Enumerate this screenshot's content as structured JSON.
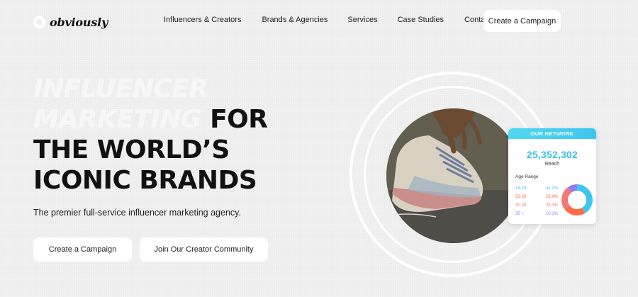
{
  "brand": {
    "name": "obviously"
  },
  "nav": {
    "links": [
      "Influencers & Creators",
      "Brands & Agencies",
      "Services",
      "Case Studies",
      "Contact"
    ],
    "cta": "Create a Campaign"
  },
  "hero": {
    "ghost_line1": "INFLUENCER",
    "ghost_line2": "MARKETING",
    "line2_rest": "FOR",
    "line3": "THE WORLD’S",
    "line4": "ICONIC BRANDS",
    "subtitle": "The premier full-service influencer marketing agency.",
    "btn_campaign": "Create a Campaign",
    "btn_community": "Join Our Creator Community"
  },
  "network_card": {
    "header": "OUR NETWORK",
    "total": "25,352,302",
    "total_label": "Reach",
    "age_label": "Age Range",
    "rows": [
      {
        "range": "18-24",
        "pct": "41.2%",
        "color": "#3ec5f0"
      },
      {
        "range": "25-29",
        "pct": "23.4%",
        "color": "#ff6a4a"
      },
      {
        "range": "30-34",
        "pct": "25.3%",
        "color": "#f07a7a"
      },
      {
        "range": "35 +",
        "pct": "10.1%",
        "color": "#8c7cf0"
      }
    ]
  },
  "colors": {
    "accent": "#3ec5f0",
    "background": "#ececec"
  }
}
